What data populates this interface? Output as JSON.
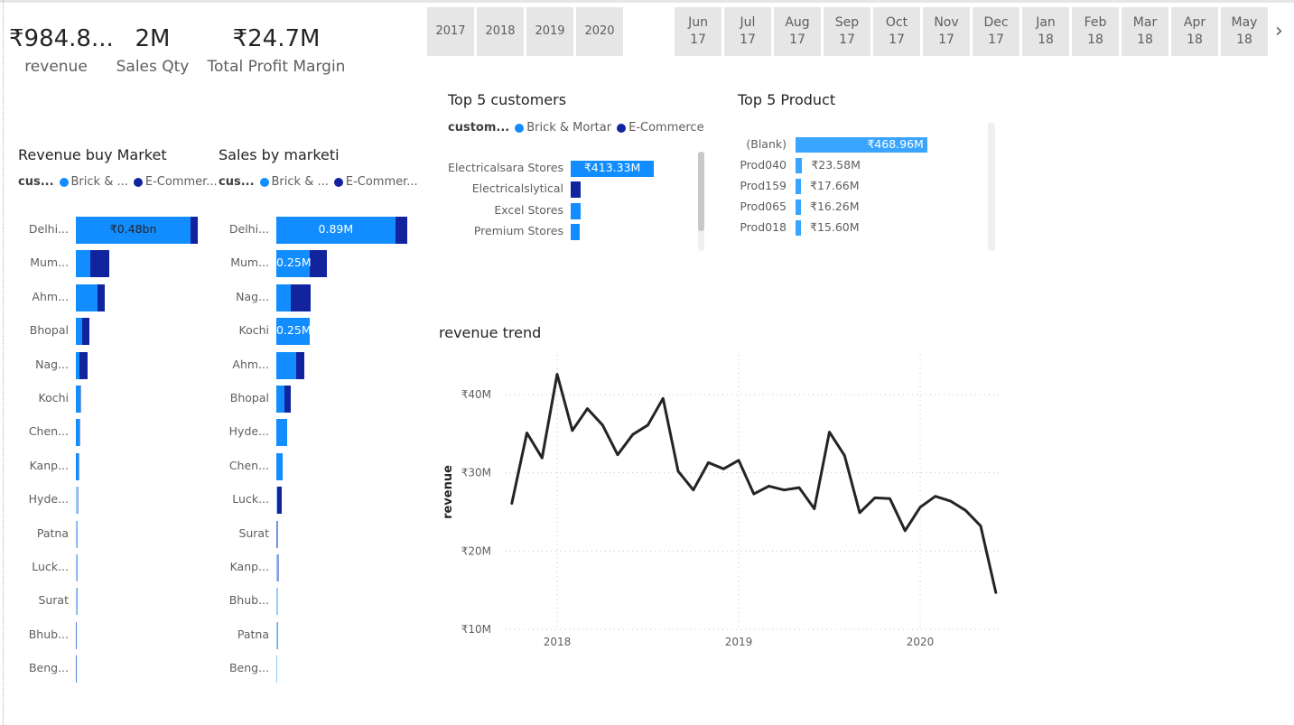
{
  "kpis": [
    {
      "value": "₹984.8...",
      "label": "revenue"
    },
    {
      "value": "2M",
      "label": "Sales Qty"
    },
    {
      "value": "₹24.7M",
      "label": "Total Profit Margin"
    }
  ],
  "year_slicer": [
    "2017",
    "2018",
    "2019",
    "2020"
  ],
  "month_slicer": [
    {
      "m": "Jun",
      "y": "17"
    },
    {
      "m": "Jul",
      "y": "17"
    },
    {
      "m": "Aug",
      "y": "17"
    },
    {
      "m": "Sep",
      "y": "17"
    },
    {
      "m": "Oct",
      "y": "17"
    },
    {
      "m": "Nov",
      "y": "17"
    },
    {
      "m": "Dec",
      "y": "17"
    },
    {
      "m": "Jan",
      "y": "18"
    },
    {
      "m": "Feb",
      "y": "18"
    },
    {
      "m": "Mar",
      "y": "18"
    },
    {
      "m": "Apr",
      "y": "18"
    },
    {
      "m": "May",
      "y": "18"
    }
  ],
  "colors": {
    "brick": "#118DFF",
    "ecom": "#12239E",
    "top5": "#3AA5FF",
    "line": "#252423"
  },
  "legend": {
    "title": "custom...",
    "title_short": "cus...",
    "brick": "Brick & Mortar",
    "brick_short": "Brick & ...",
    "ecom": "E-Commerce",
    "ecom_short": "E-Commer..."
  },
  "chart_data": [
    {
      "type": "bar",
      "orientation": "horizontal-stacked",
      "title": "Revenue buy Market",
      "categories": [
        "Delhi...",
        "Mum...",
        "Ahm...",
        "Bhopal",
        "Nag...",
        "Kochi",
        "Chen...",
        "Kanp...",
        "Hyde...",
        "Patna",
        "Luck...",
        "Surat",
        "Bhub...",
        "Beng..."
      ],
      "series": [
        {
          "name": "Brick & Mortar",
          "values": [
            0.48,
            0.06,
            0.09,
            0.025,
            0.015,
            0.018,
            0.016,
            0.012,
            0.007,
            0.003,
            0.002,
            0.002,
            0.001,
            0.0005
          ]
        },
        {
          "name": "E-Commerce",
          "values": [
            0.03,
            0.08,
            0.03,
            0.03,
            0.035,
            0.002,
            0.002,
            0.002,
            0.001,
            0.002,
            0.001,
            0.001,
            0.0005,
            0.0002
          ]
        }
      ],
      "data_labels": [
        "₹0.48bn"
      ],
      "unit": "₹bn"
    },
    {
      "type": "bar",
      "orientation": "horizontal-stacked",
      "title": "Sales by marketi",
      "categories": [
        "Delhi...",
        "Mum...",
        "Nag...",
        "Kochi",
        "Ahm...",
        "Bhopal",
        "Hyde...",
        "Chen...",
        "Luck...",
        "Surat",
        "Kanp...",
        "Bhub...",
        "Patna",
        "Beng..."
      ],
      "series": [
        {
          "name": "Brick & Mortar",
          "values": [
            0.89,
            0.25,
            0.11,
            0.25,
            0.15,
            0.06,
            0.08,
            0.05,
            0.005,
            0.003,
            0.01,
            0.015,
            0.005,
            0.002
          ]
        },
        {
          "name": "E-Commerce",
          "values": [
            0.09,
            0.13,
            0.15,
            0.0,
            0.06,
            0.05,
            0.0,
            0.0,
            0.035,
            0.012,
            0.008,
            0.0,
            0.005,
            0.0
          ]
        }
      ],
      "data_labels": [
        "0.89M",
        "0.25M",
        "",
        "0.25M"
      ],
      "unit": "M"
    },
    {
      "type": "bar",
      "orientation": "horizontal-stacked",
      "title": "Top 5 customers",
      "categories": [
        "Electricalsara Stores",
        "Electricalslytical",
        "Excel Stores",
        "Premium Stores"
      ],
      "series": [
        {
          "name": "Brick & Mortar",
          "values": [
            413.33,
            0,
            50,
            46
          ]
        },
        {
          "name": "E-Commerce",
          "values": [
            0,
            50,
            0,
            0
          ]
        }
      ],
      "data_labels": [
        "₹413.33M"
      ],
      "unit": "₹M"
    },
    {
      "type": "bar",
      "orientation": "horizontal",
      "title": "Top 5 Product",
      "categories": [
        "(Blank)",
        "Prod040",
        "Prod159",
        "Prod065",
        "Prod018"
      ],
      "values": [
        468.96,
        23.58,
        17.66,
        16.26,
        15.6
      ],
      "data_labels": [
        "₹468.96M",
        "₹23.58M",
        "₹17.66M",
        "₹16.26M",
        "₹15.60M"
      ],
      "unit": "₹M"
    },
    {
      "type": "line",
      "title": "revenue trend",
      "ylabel": "revenue",
      "xlabel": "",
      "x_ticks": [
        "2018",
        "2019",
        "2020"
      ],
      "y_ticks": [
        "₹10M",
        "₹20M",
        "₹30M",
        "₹40M"
      ],
      "ylim": [
        10,
        45
      ],
      "xlim": [
        "2017-08",
        "2020-06"
      ],
      "grid": true,
      "x": [
        "2017-10",
        "2017-11",
        "2017-12",
        "2018-01",
        "2018-02",
        "2018-03",
        "2018-04",
        "2018-05",
        "2018-06",
        "2018-07",
        "2018-08",
        "2018-09",
        "2018-10",
        "2018-11",
        "2018-12",
        "2019-01",
        "2019-02",
        "2019-03",
        "2019-04",
        "2019-05",
        "2019-06",
        "2019-07",
        "2019-08",
        "2019-09",
        "2019-10",
        "2019-11",
        "2019-12",
        "2020-01",
        "2020-02",
        "2020-03",
        "2020-04",
        "2020-05",
        "2020-06"
      ],
      "values": [
        26.1,
        35.1,
        31.9,
        42.6,
        35.4,
        38.2,
        36.1,
        32.3,
        34.9,
        36.1,
        39.5,
        30.2,
        27.8,
        31.3,
        30.5,
        31.6,
        27.3,
        28.3,
        27.8,
        28.1,
        25.4,
        35.2,
        32.2,
        24.9,
        26.8,
        26.7,
        22.6,
        25.6,
        27.0,
        26.4,
        25.2,
        23.2,
        14.7
      ]
    }
  ]
}
